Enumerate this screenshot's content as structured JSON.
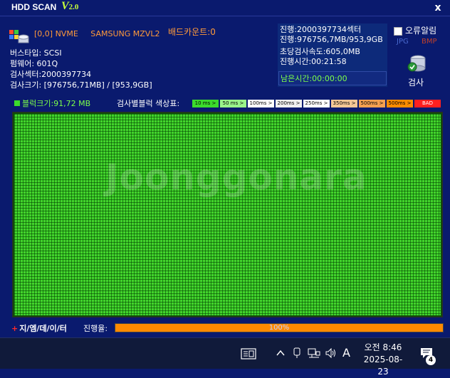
{
  "app": {
    "title": "HDD SCAN",
    "version_v": "V",
    "version_num": "2.0",
    "close": "x"
  },
  "drive": {
    "id": "[0,0] NVME",
    "model": "SAMSUNG MZVL2",
    "bus_type": "버스타입: SCSI",
    "firmware": "펌웨어: 601Q",
    "sectors": "검사섹터:2000397734",
    "size": "검사크기: [976756,71MB] / [953,9GB]"
  },
  "bad_count": "배드카운트:0",
  "progress_info": {
    "sector_progress": "진행:2000397734섹터",
    "size_progress": "진행:976756,7MB/953,9GB",
    "speed": "초당검사속도:605,0MB",
    "elapsed": "진행시간:00:21:58",
    "remaining": "남은시간:00:00:00"
  },
  "options": {
    "error_alert_label": "오류알림",
    "format_jpg": "JPG",
    "format_bmp": "BMP",
    "scan_button": "검사"
  },
  "legend": {
    "block_size": "블럭크기:91,72 MB",
    "title": "검사별블럭 색상표:",
    "cells": [
      {
        "label": "10 ms >",
        "color": "#3cdc2c"
      },
      {
        "label": "50 ms >",
        "color": "#9af58a"
      },
      {
        "label": "100ms >",
        "color": "#ffffff"
      },
      {
        "label": "200ms >",
        "color": "#f0f0f0"
      },
      {
        "label": "250ms >",
        "color": "#ffffff"
      },
      {
        "label": "350ms >",
        "color": "#f5c896"
      },
      {
        "label": "500ms >",
        "color": "#f5a050"
      },
      {
        "label": "500ms >",
        "color": "#ff8c00"
      },
      {
        "label": "BAD",
        "color": "#ff2020"
      }
    ]
  },
  "grid": {
    "block_color": "#42d42c"
  },
  "watermark": "Joonggonara",
  "footer": {
    "brand_plus": "+",
    "brand": "지/엠/데/이/터",
    "progress_label": "진행율:",
    "progress_value": 1.0,
    "progress_text": "100%"
  },
  "taskbar": {
    "ime": "A",
    "time_period": "오전 8:46",
    "date": "2025-08-23",
    "notification_count": "4"
  }
}
